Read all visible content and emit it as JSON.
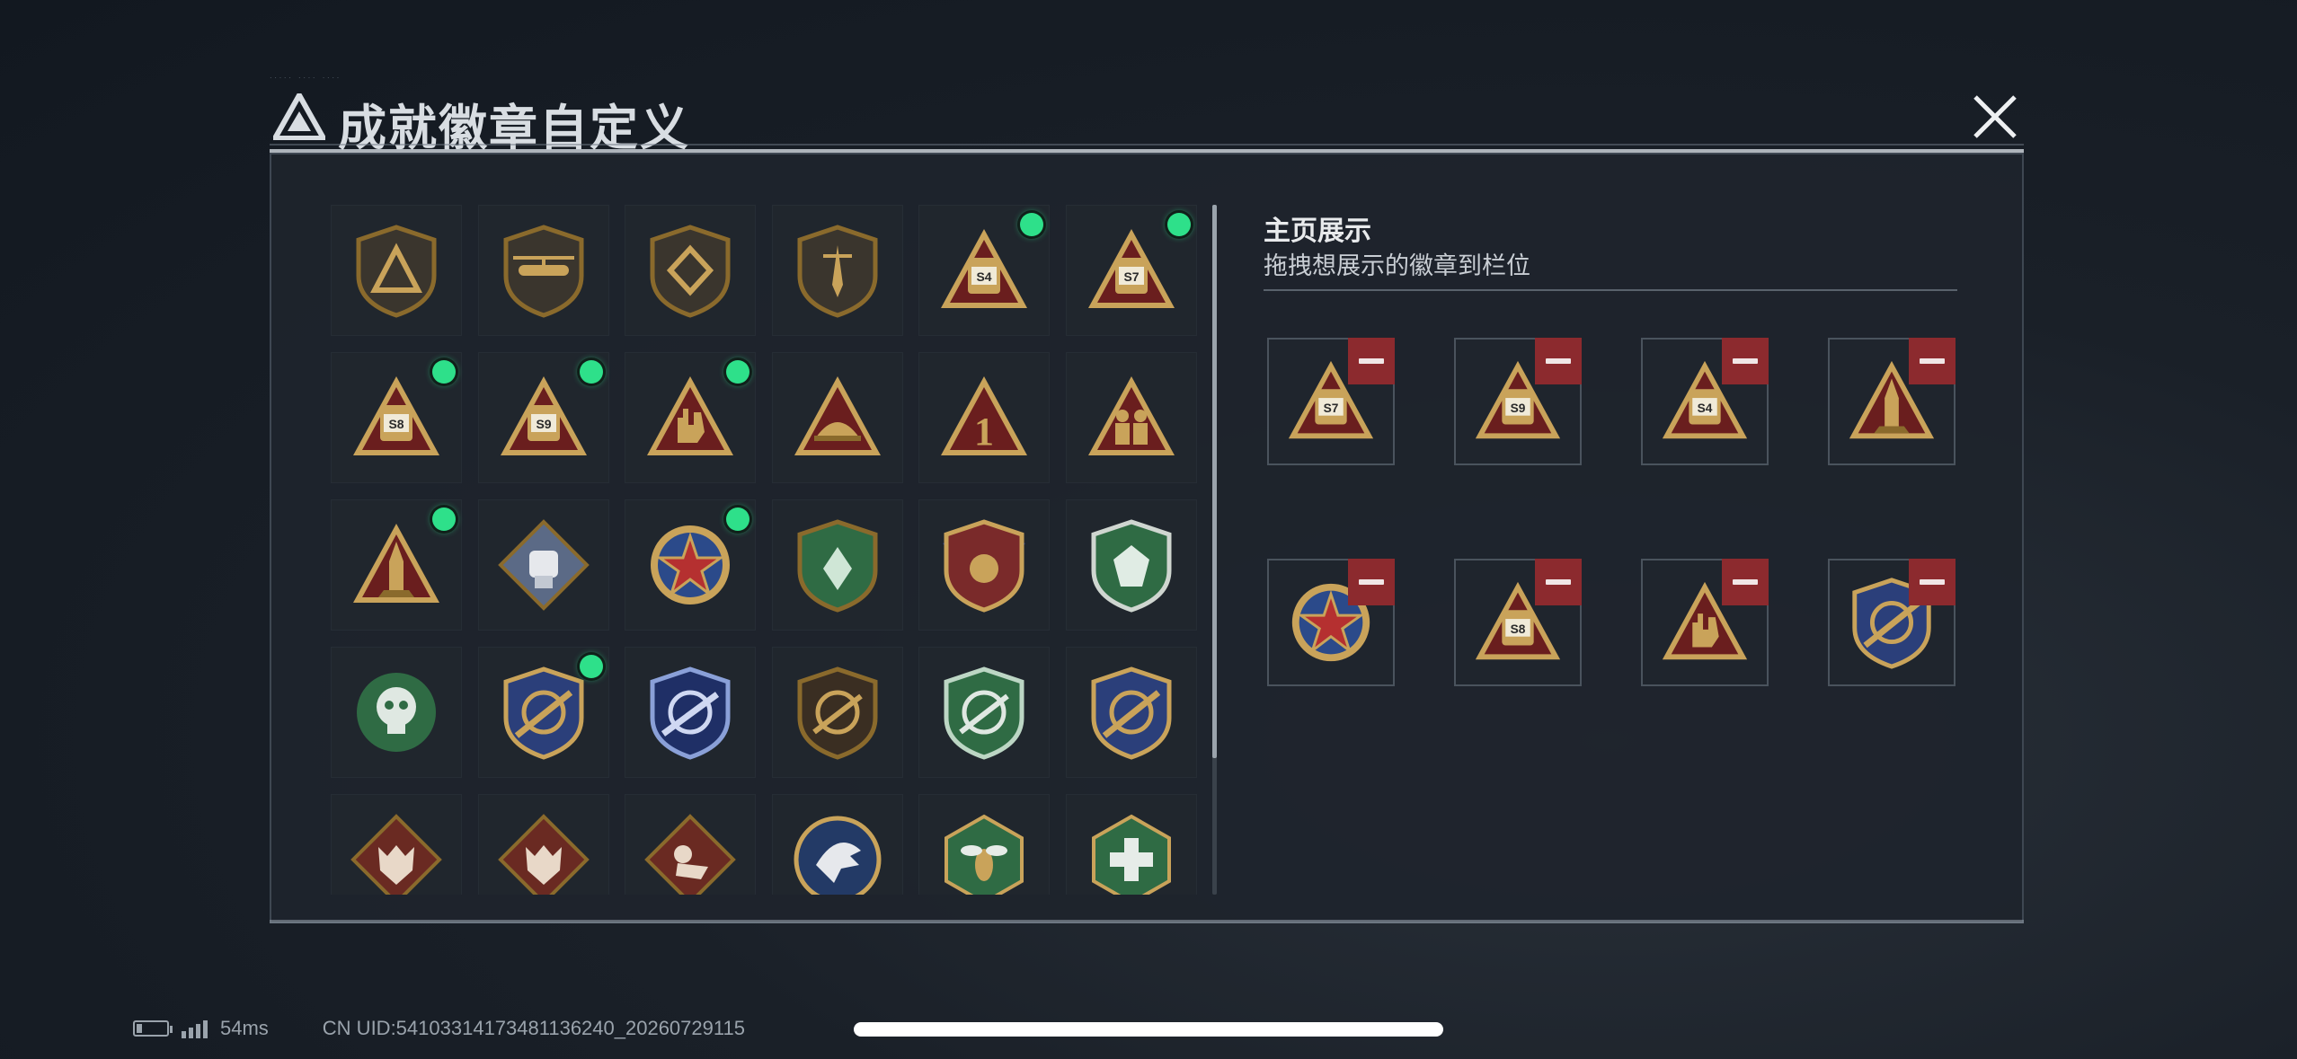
{
  "dialog": {
    "title": "成就徽章自定义",
    "close_label": "close"
  },
  "showcase": {
    "title": "主页展示",
    "subtitle": "拖拽想展示的徽章到栏位"
  },
  "badges": [
    {
      "icon": "shield-triangle-badge-icon",
      "new": false
    },
    {
      "icon": "helicopter-badge-icon",
      "new": false
    },
    {
      "icon": "shield-diamond-badge-icon",
      "new": false
    },
    {
      "icon": "shield-dagger-badge-icon",
      "new": false
    },
    {
      "icon": "s4-triangle-badge-icon",
      "new": true,
      "label": "S4"
    },
    {
      "icon": "s7-triangle-badge-icon",
      "new": true,
      "label": "S7"
    },
    {
      "icon": "s8-triangle-badge-icon",
      "new": true,
      "label": "S8"
    },
    {
      "icon": "s9-triangle-badge-icon",
      "new": true,
      "label": "S9"
    },
    {
      "icon": "hand-triangle-badge-icon",
      "new": true
    },
    {
      "icon": "helmet-triangle-badge-icon",
      "new": false
    },
    {
      "icon": "number-one-triangle-badge-icon",
      "new": false,
      "label": "1"
    },
    {
      "icon": "soldiers-triangle-badge-icon",
      "new": false
    },
    {
      "icon": "rocket-triangle-badge-icon",
      "new": true
    },
    {
      "icon": "fist-diamond-badge-icon",
      "new": false
    },
    {
      "icon": "star-medal-badge-icon",
      "new": true
    },
    {
      "icon": "green-shield-badge-icon",
      "new": false
    },
    {
      "icon": "winged-medal-badge-icon",
      "new": false
    },
    {
      "icon": "green-gem-shield-badge-icon",
      "new": false
    },
    {
      "icon": "green-skull-badge-icon",
      "new": false
    },
    {
      "icon": "gold-rifle-shield-badge-icon",
      "new": true
    },
    {
      "icon": "blue-rifle-shield-badge-icon",
      "new": false
    },
    {
      "icon": "bronze-rifle-shield-badge-icon",
      "new": false
    },
    {
      "icon": "green-rifle-shield-badge-icon",
      "new": false
    },
    {
      "icon": "gold-bullet-shield-badge-icon",
      "new": false
    },
    {
      "icon": "wolf-diamond-badge-icon",
      "new": false
    },
    {
      "icon": "wolf-diamond-2-badge-icon",
      "new": false
    },
    {
      "icon": "crawling-diamond-badge-icon",
      "new": false
    },
    {
      "icon": "eagle-circle-badge-icon",
      "new": false
    },
    {
      "icon": "wasp-hexagon-badge-icon",
      "new": false
    },
    {
      "icon": "medic-hexagon-badge-icon",
      "new": false
    }
  ],
  "slots": [
    {
      "icon": "s7-triangle-badge-icon",
      "label": "S7"
    },
    {
      "icon": "s9-triangle-badge-icon",
      "label": "S9"
    },
    {
      "icon": "s4-triangle-badge-icon",
      "label": "S4"
    },
    {
      "icon": "rocket-triangle-badge-icon"
    },
    {
      "icon": "star-medal-badge-icon"
    },
    {
      "icon": "s8-triangle-badge-icon",
      "label": "S8"
    },
    {
      "icon": "hand-triangle-badge-icon"
    },
    {
      "icon": "gold-rifle-shield-badge-icon"
    }
  ],
  "status": {
    "ping": "54ms",
    "uid": "CN UID:5410331417348113624​0_2026072911​5"
  },
  "colors": {
    "accent_green": "#2ee08a",
    "remove_red": "#8c2a2e",
    "gold": "#c9a35a",
    "triangle_red": "#6a1e1e"
  }
}
